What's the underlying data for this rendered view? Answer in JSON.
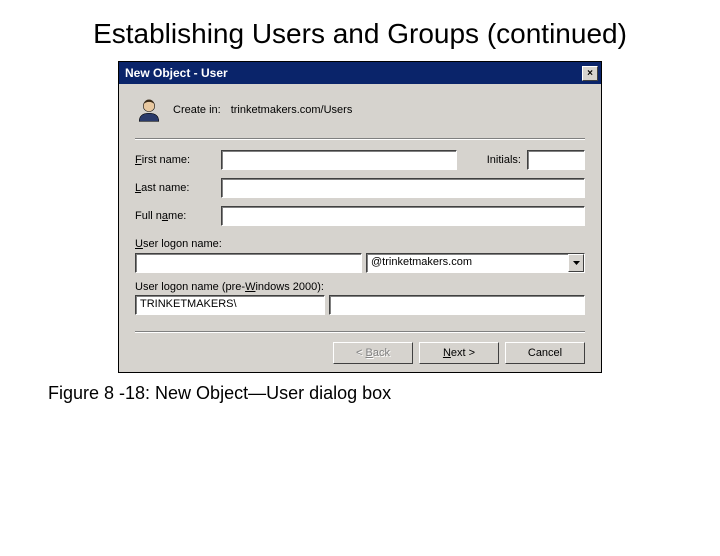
{
  "slide": {
    "title": "Establishing Users and Groups (continued)",
    "caption": "Figure 8 -18: New Object—User dialog box"
  },
  "dialog": {
    "title": "New Object - User",
    "closeGlyph": "×",
    "createInLabel": "Create in:",
    "createInPath": "trinketmakers.com/Users",
    "labels": {
      "firstName": "First name:",
      "initials": "Initials:",
      "lastName": "Last name:",
      "fullName": "Full name:",
      "logon": "User logon name:",
      "logonPre": "User logon name (pre-Windows 2000):"
    },
    "fields": {
      "firstName": "",
      "initials": "",
      "lastName": "",
      "fullName": "",
      "logonName": "",
      "upnSuffix": "@trinketmakers.com",
      "preDomain": "TRINKETMAKERS\\",
      "preName": ""
    },
    "buttons": {
      "back": "< Back",
      "next": "Next >",
      "cancel": "Cancel"
    }
  }
}
